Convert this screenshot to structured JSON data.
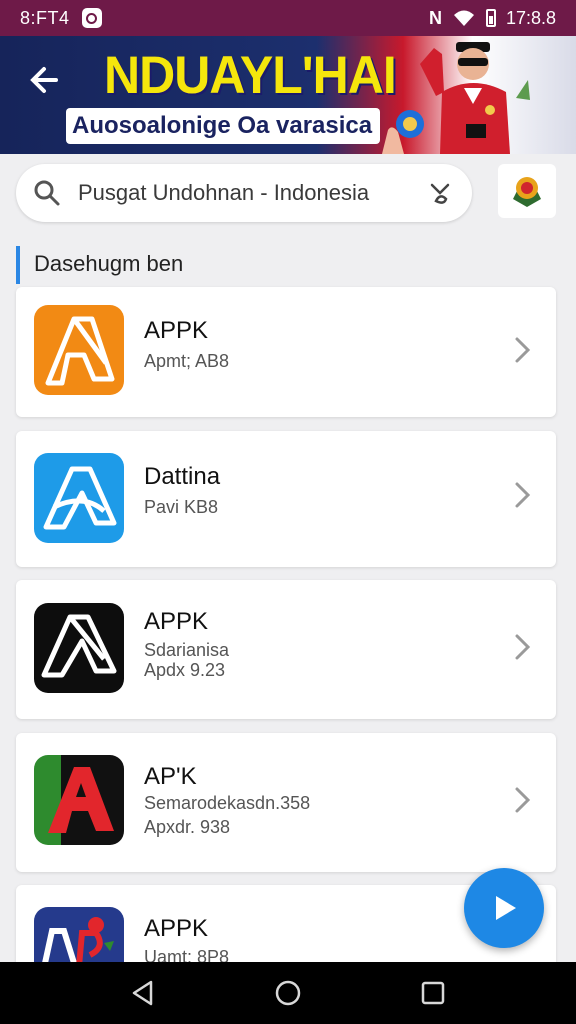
{
  "status_bar": {
    "time": "8:FT4",
    "clock": "17:8.8",
    "nfc": "N"
  },
  "banner": {
    "headline": "NDUAYL'HAI",
    "subline": "Auosoalonige Oa varasica"
  },
  "search": {
    "query": "Pusgat Undohnan - Indonesia"
  },
  "section": {
    "title": "Dasehugm ben"
  },
  "apps": [
    {
      "name": "APPK",
      "meta1": "Apmt; AB8",
      "meta2": "",
      "icon": "apk-orange-icon"
    },
    {
      "name": "Dattina",
      "meta1": "Pavi KB8",
      "meta2": "",
      "icon": "apk-blue-icon"
    },
    {
      "name": "APPK",
      "meta1": "Sdarianisa",
      "meta2": "Apdx 9.23",
      "icon": "apk-black-icon"
    },
    {
      "name": "AP'K",
      "meta1": "Semarodekasdn.358",
      "meta2": "Apxdr. 938",
      "icon": "apk-red-icon"
    },
    {
      "name": "APPK",
      "meta1": "Uamt: 8P8",
      "meta2": "",
      "icon": "apk-multicolor-icon"
    }
  ],
  "colors": {
    "status_bar": "#6e1a48",
    "accent": "#2b87e4",
    "fab": "#1e88e5"
  }
}
